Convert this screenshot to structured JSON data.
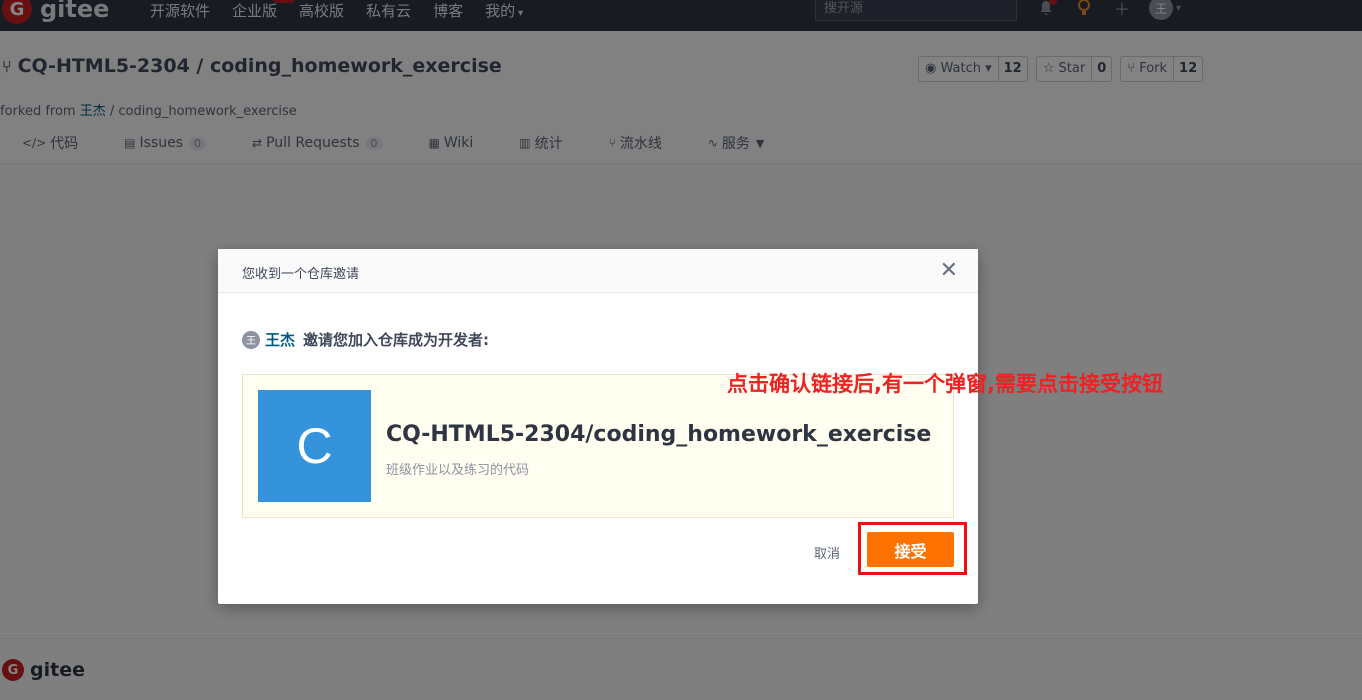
{
  "topnav": {
    "logo_mark": "G",
    "logo_text": "gitee",
    "links": [
      "开源软件",
      "企业版",
      "高校版",
      "私有云",
      "博客",
      "我的"
    ],
    "enterprise_badge": "特惠",
    "search_placeholder": "搜开源",
    "avatar_text": "王"
  },
  "repo": {
    "title": "CQ-HTML5-2304 / coding_homework_exercise",
    "forked_prefix": "forked from ",
    "forked_owner": "王杰",
    "forked_rest": " / coding_homework_exercise",
    "watch_label": "Watch",
    "watch_count": "12",
    "star_label": "Star",
    "star_count": "0",
    "fork_label": "Fork",
    "fork_count": "12"
  },
  "tabs": [
    {
      "icon": "</>",
      "label": "代码",
      "count": ""
    },
    {
      "icon": "▤",
      "label": "Issues",
      "count": "0"
    },
    {
      "icon": "⇄",
      "label": "Pull Requests",
      "count": "0"
    },
    {
      "icon": "▦",
      "label": "Wiki",
      "count": ""
    },
    {
      "icon": "▥",
      "label": "统计",
      "count": ""
    },
    {
      "icon": "⑂",
      "label": "流水线",
      "count": ""
    },
    {
      "icon": "∿",
      "label": "服务",
      "count": ""
    }
  ],
  "modal": {
    "title": "您收到一个仓库邀请",
    "inviter_avatar": "王",
    "inviter_name": "王杰",
    "invite_text": "邀请您加入仓库成为开发者:",
    "repo_avatar_letter": "C",
    "repo_full_name": "CQ-HTML5-2304/coding_homework_exercise",
    "repo_description": "班级作业以及练习的代码",
    "cancel_label": "取消",
    "accept_label": "接受"
  },
  "annotation": {
    "text": "点击确认链接后,有一个弹窗,需要点击接受按钮"
  },
  "footer": {
    "logo_mark": "G",
    "logo_text": "gitee"
  },
  "colors": {
    "accept": "#fe7300",
    "brand": "#c71d23",
    "repo_avatar": "#3493db",
    "annotation": "#ee2222"
  }
}
